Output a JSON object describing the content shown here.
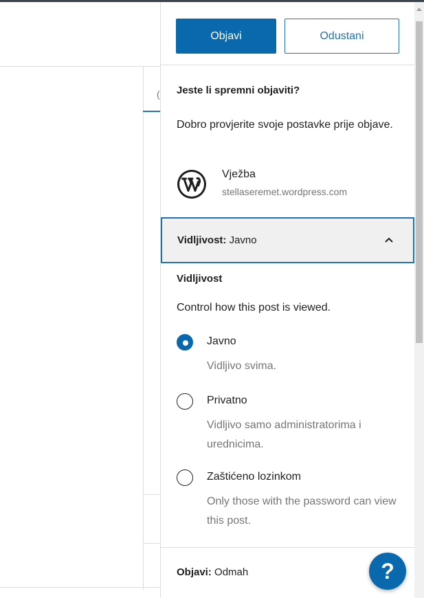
{
  "header": {
    "publish_label": "Objavi",
    "cancel_label": "Odustani"
  },
  "prepublish": {
    "title": "Jeste li spremni objaviti?",
    "description": "Dobro provjerite svoje postavke prije objave.",
    "site": {
      "name": "Vježba",
      "url": "stellaseremet.wordpress.com",
      "icon": "wordpress-icon"
    }
  },
  "visibility": {
    "toggle_prefix": "Vidljivost:",
    "toggle_value": "Javno",
    "heading": "Vidljivost",
    "help": "Control how this post is viewed.",
    "options": [
      {
        "label": "Javno",
        "description": "Vidljivo svima.",
        "checked": true
      },
      {
        "label": "Privatno",
        "description": "Vidljivo samo administratorima i urednicima.",
        "checked": false
      },
      {
        "label": "Zaštićeno lozinkom",
        "description": "Only those with the password can view this post.",
        "checked": false
      }
    ]
  },
  "publish": {
    "prefix": "Objavi:",
    "value": "Odmah"
  },
  "help_button": {
    "label": "?"
  },
  "editor": {
    "tab_hint": "("
  },
  "colors": {
    "accent": "#0a69ad",
    "link": "#2271b1",
    "text": "#1e1e1e",
    "muted": "#757575"
  }
}
